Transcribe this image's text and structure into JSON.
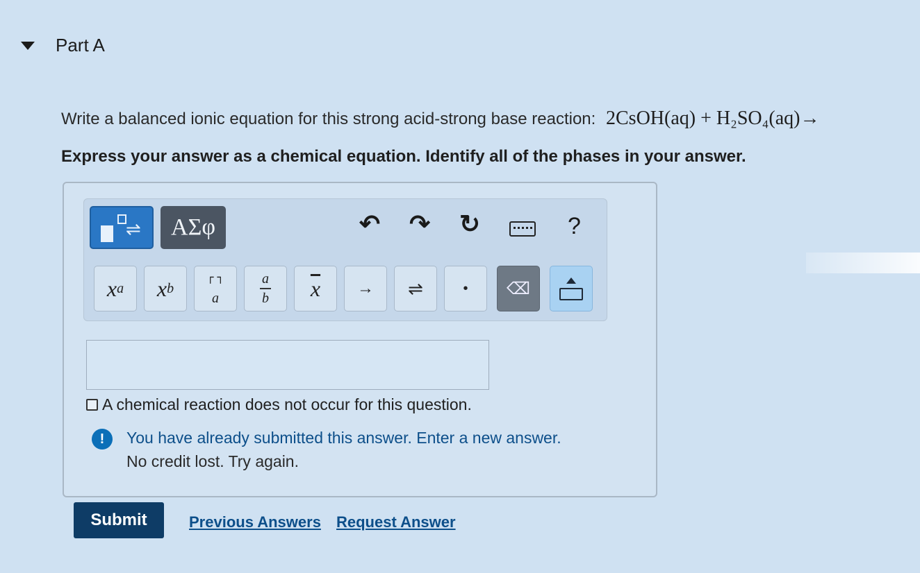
{
  "part": {
    "title": "Part A"
  },
  "question": {
    "prompt": "Write a balanced ionic equation for this strong acid-strong base reaction:",
    "equation": "2CsOH(aq) + H₂SO₄(aq)→",
    "instruction": "Express your answer as a chemical equation. Identify all of the phases in your answer."
  },
  "toolbar": {
    "greek_label": "ΑΣφ",
    "help_label": "?",
    "symbols": {
      "superscript": "x",
      "superscript_exp": "a",
      "subscript": "x",
      "subscript_idx": "b",
      "charge_top": "┌ ┐",
      "charge_bottom": "a",
      "frac_num": "a",
      "frac_den": "b",
      "overline": "x",
      "arrow": "→",
      "equilibrium": "⇌",
      "dot": "•",
      "delete": "⌫"
    }
  },
  "answer": {
    "value": "",
    "no_reaction_label": "A chemical reaction does not occur for this question.",
    "no_reaction_checked": false
  },
  "feedback": {
    "line1": "You have already submitted this answer. Enter a new answer.",
    "line2": "No credit lost. Try again."
  },
  "actions": {
    "submit_label": "Submit",
    "previous_answers_label": "Previous Answers",
    "request_answer_label": "Request Answer"
  },
  "colors": {
    "accent": "#2a77c5",
    "submit_bg": "#0e3c66",
    "link": "#0d4f8a",
    "warning_icon": "#0b6fb8"
  }
}
